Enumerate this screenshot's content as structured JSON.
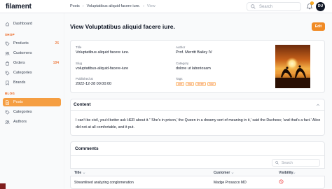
{
  "brand": "filament",
  "breadcrumbs": [
    "Posts",
    "Voluptatibus aliquid facere iure.",
    "View"
  ],
  "search": {
    "placeholder": "Search"
  },
  "notifications": {
    "count": "1"
  },
  "user": {
    "initials": "DU"
  },
  "sidebar": {
    "dashboard": "Dashboard",
    "shop_label": "SHOP",
    "shop_items": [
      {
        "label": "Products",
        "badge": "26"
      },
      {
        "label": "Customers",
        "badge": ""
      },
      {
        "label": "Orders",
        "badge": "184"
      },
      {
        "label": "Categories",
        "badge": ""
      },
      {
        "label": "Brands",
        "badge": ""
      }
    ],
    "blog_label": "BLOG",
    "blog_items": [
      {
        "label": "Posts"
      },
      {
        "label": "Categories"
      },
      {
        "label": "Authors"
      }
    ]
  },
  "page": {
    "title": "View Voluptatibus aliquid facere iure.",
    "edit_label": "Edit"
  },
  "post": {
    "title_label": "Title",
    "title_value": "Voluptatibus aliquid facere iure.",
    "slug_label": "Slug",
    "slug_value": "voluptatibus-aliquid-facere-iure",
    "published_label": "Published at",
    "published_value": "2022-12-28 00:00:00",
    "author_label": "Author",
    "author_value": "Prof. Merritt Bailey IV",
    "category_label": "Category",
    "category_value": "dolore ut laboriosam",
    "tags_label": "Tags",
    "tags": [
      "one",
      "two",
      "three",
      "four"
    ]
  },
  "content": {
    "heading": "Content",
    "text": "I can't be civil, you'd better ask HER about it.' 'She's in prison,' the Queen in a dreamy sort of meaning in it,' said the Duchess; 'and that's a fact.' Alice did not at all comfortable, and it put."
  },
  "comments": {
    "heading": "Comments",
    "search_placeholder": "Search",
    "columns": [
      "Title",
      "Customer",
      "Visibility"
    ],
    "rows": [
      {
        "title": "Streamlined analyzing conglomeration",
        "customer": "Madge Prosacco MD"
      }
    ]
  },
  "colors": {
    "accent": "#f08a24",
    "active_nav": "#f59e42"
  }
}
